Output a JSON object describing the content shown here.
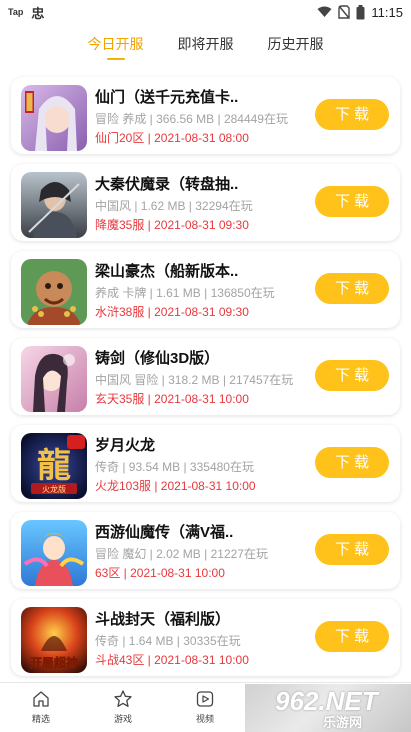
{
  "status": {
    "left_label": "Tap",
    "left_glyph": "忠",
    "time": "11:15"
  },
  "tabs": [
    {
      "label": "今日开服",
      "active": true
    },
    {
      "label": "即将开服",
      "active": false
    },
    {
      "label": "历史开服",
      "active": false
    }
  ],
  "games": [
    {
      "title": "仙门（送千元充值卡..",
      "meta": "冒险  养成 | 366.56 MB | 284449在玩",
      "server": "仙门20区 | 2021-08-31 08:00",
      "button": "下载",
      "icon": "game-icon-xianmen"
    },
    {
      "title": "大秦伏魔录（转盘抽..",
      "meta": "中国风 | 1.62 MB | 32294在玩",
      "server": "降魔35服 | 2021-08-31 09:30",
      "button": "下载",
      "icon": "game-icon-daqin"
    },
    {
      "title": "梁山豪杰（船新版本..",
      "meta": "养成  卡牌 | 1.61 MB | 136850在玩",
      "server": "水浒38服 | 2021-08-31 09:30",
      "button": "下载",
      "icon": "game-icon-liangshan"
    },
    {
      "title": "铸剑（修仙3D版）",
      "meta": "中国风  冒险 | 318.2 MB | 217457在玩",
      "server": "玄天35服 | 2021-08-31 10:00",
      "button": "下载",
      "icon": "game-icon-zhujian"
    },
    {
      "title": "岁月火龙",
      "meta": "传奇 | 93.54 MB | 335480在玩",
      "server": "火龙103服 | 2021-08-31 10:00",
      "button": "下载",
      "icon": "game-icon-huolong"
    },
    {
      "title": "西游仙魔传（满V福..",
      "meta": "冒险  魔幻 | 2.02 MB | 21227在玩",
      "server": "63区 | 2021-08-31 10:00",
      "button": "下载",
      "icon": "game-icon-xiyou"
    },
    {
      "title": "斗战封天（福利版）",
      "meta": "传奇 | 1.64 MB | 30335在玩",
      "server": "斗战43区 | 2021-08-31 10:00",
      "button": "下载",
      "icon": "game-icon-douzhan"
    }
  ],
  "thumb_text": {
    "huolong": "龍",
    "huolong_sub": "火龙版",
    "douzhan": "开局超神"
  },
  "nav": [
    {
      "label": "精选",
      "icon": "home-icon"
    },
    {
      "label": "游戏",
      "icon": "star-icon"
    },
    {
      "label": "视频",
      "icon": "video-play-icon"
    }
  ],
  "watermark": {
    "line1": "962.NET",
    "line2": "乐游网"
  },
  "colors": {
    "accent": "#f4a300",
    "button": "#ffc21a",
    "server_text": "#e8383d"
  }
}
